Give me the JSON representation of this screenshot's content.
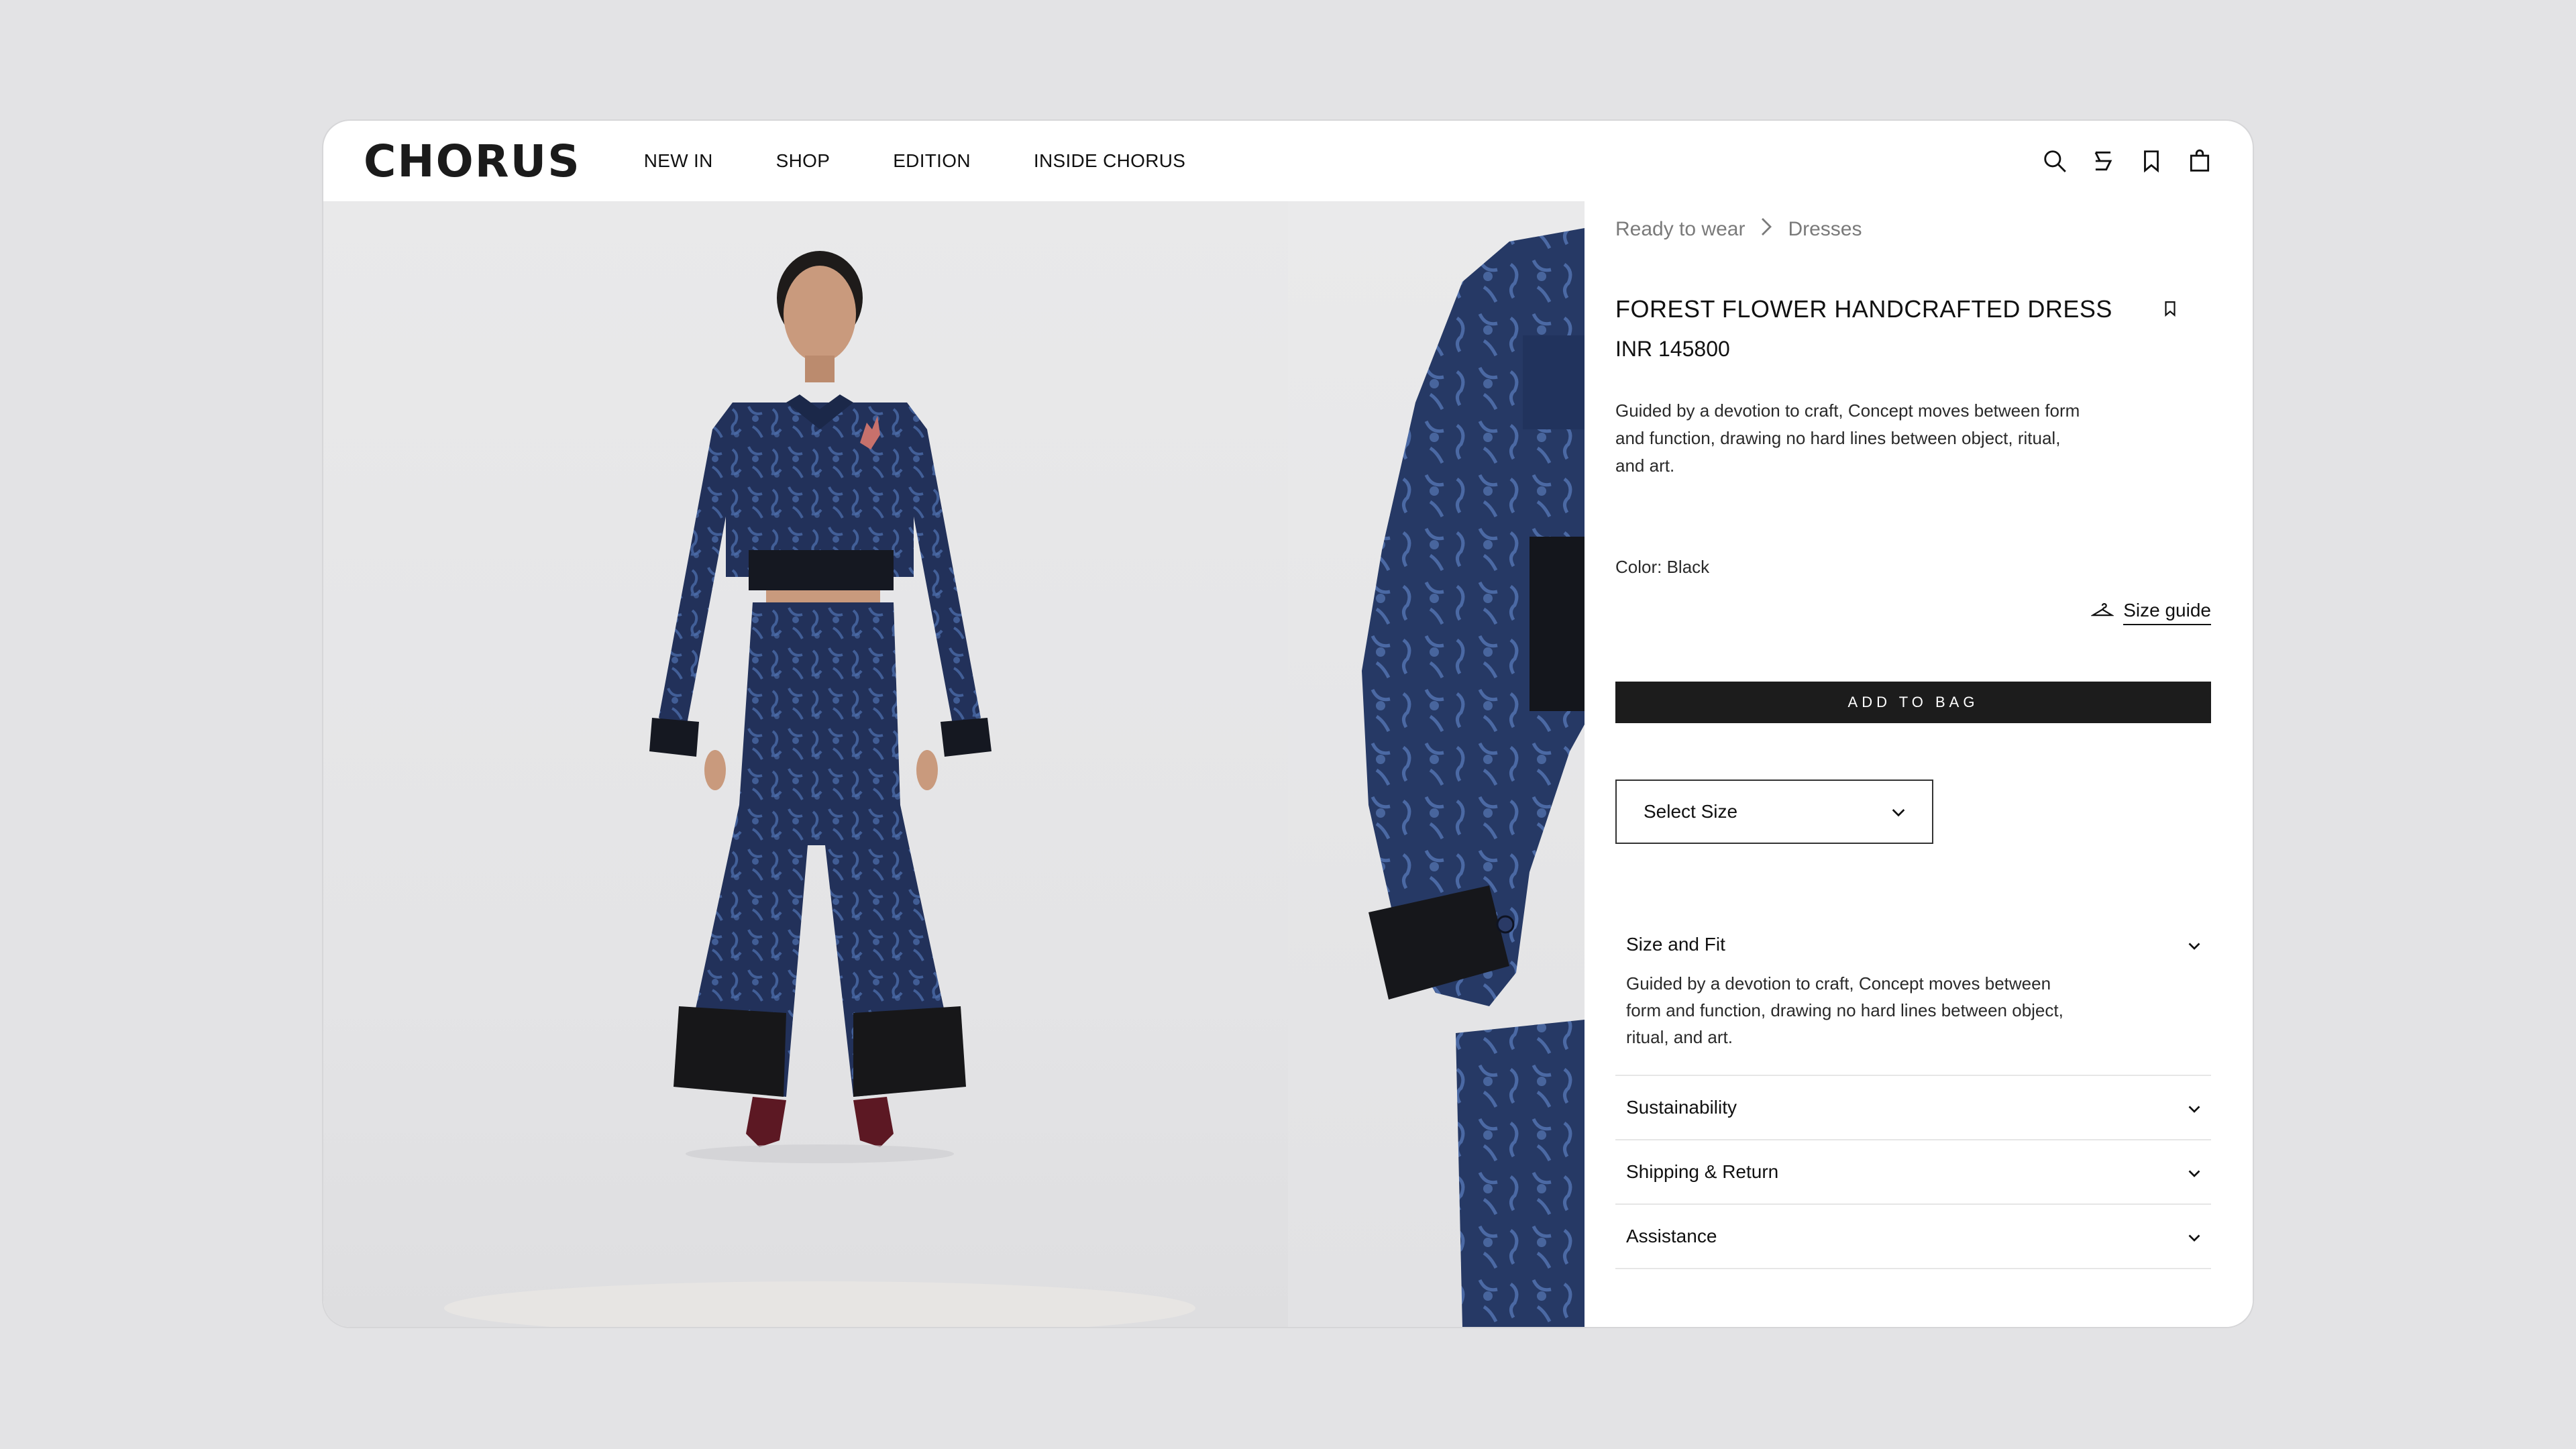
{
  "header": {
    "logo": "CHORUS",
    "nav": [
      "NEW IN",
      "SHOP",
      "EDITION",
      "INSIDE CHORUS"
    ]
  },
  "breadcrumb": {
    "items": [
      "Ready to wear",
      "Dresses"
    ]
  },
  "product": {
    "title": "FOREST FLOWER HANDCRAFTED DRESS",
    "price": "INR 145800",
    "description": "Guided by a devotion to craft, Concept moves between form and function, drawing no hard lines between object, ritual, and art.",
    "color_label": "Color: Black"
  },
  "size": {
    "placeholder": "Select Size",
    "guide_label": "Size guide"
  },
  "cta": {
    "add_to_bag": "ADD TO BAG"
  },
  "accordion": [
    {
      "title": "Size and Fit",
      "open": true,
      "body": "Guided by a devotion to craft, Concept moves between form and function, drawing no hard lines between object, ritual, and art."
    },
    {
      "title": "Sustainability",
      "open": false
    },
    {
      "title": "Shipping & Return",
      "open": false
    },
    {
      "title": "Assistance",
      "open": false
    }
  ],
  "icons": [
    "search-icon",
    "hanger-icon",
    "bookmark-icon",
    "bag-icon"
  ],
  "colors": {
    "accent": "#1c1c1c",
    "background": "#e3e3e5",
    "denim": "#22315a"
  }
}
